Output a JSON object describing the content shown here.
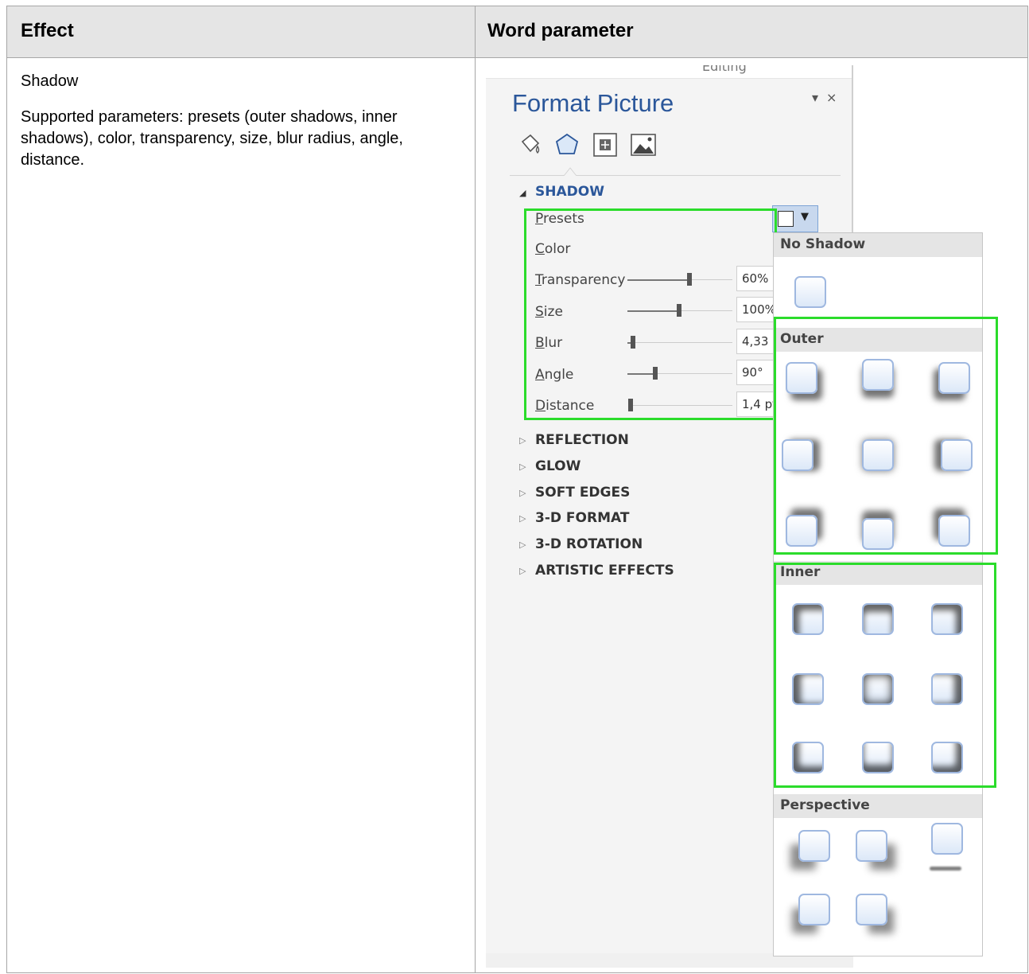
{
  "table": {
    "header": {
      "col1": "Effect",
      "col2": "Word parameter"
    },
    "row": {
      "effect": "Shadow",
      "description": "Supported parameters: presets (outer shadows, inner shadows), color, transparency, size, blur radius, angle, distance."
    }
  },
  "panel": {
    "top_partial_label": "Editing",
    "title": "Format Picture",
    "controls": {
      "menu": "▾",
      "close": "×"
    },
    "tabs": [
      "fill-line-tab",
      "effects-tab",
      "size-properties-tab",
      "picture-tab"
    ],
    "shadow": {
      "title": "SHADOW",
      "presets_label": "Presets",
      "color_label": "Color",
      "transparency": {
        "label": "Transparency",
        "value": "60%",
        "level": 0.6
      },
      "size": {
        "label": "Size",
        "value": "100%",
        "level": 0.5
      },
      "blur": {
        "label": "Blur",
        "value": "4,33 pt",
        "level": 0.05
      },
      "angle": {
        "label": "Angle",
        "value": "90°",
        "level": 0.25
      },
      "distance": {
        "label": "Distance",
        "value": "1,4 pt",
        "level": 0.02
      }
    },
    "sections": [
      "REFLECTION",
      "GLOW",
      "SOFT EDGES",
      "3-D FORMAT",
      "3-D ROTATION",
      "ARTISTIC EFFECTS"
    ]
  },
  "presets_dropdown": {
    "no_shadow": "No Shadow",
    "outer": "Outer",
    "inner": "Inner",
    "perspective": "Perspective"
  },
  "colors": {
    "accent_blue": "#2b579a",
    "highlight_green": "#2bdc2b",
    "header_gray": "#e5e5e5"
  }
}
